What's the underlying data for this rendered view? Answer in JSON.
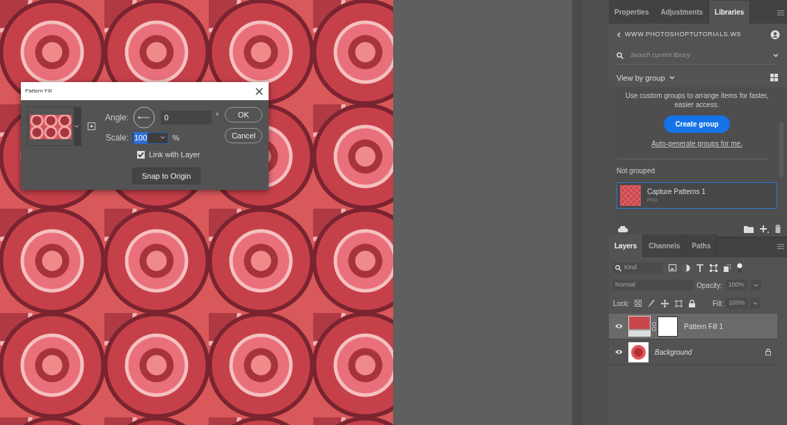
{
  "dialog": {
    "title": "Pattern Fill",
    "angle_label": "Angle:",
    "angle_value": "0",
    "degree_unit": "°",
    "scale_label": "Scale:",
    "scale_value": "100",
    "percent_unit": "%",
    "link_with_layer": {
      "label": "Link with Layer",
      "checked": true
    },
    "snap_button": "Snap to Origin",
    "ok_button": "OK",
    "cancel_button": "Cancel"
  },
  "libraries_panel": {
    "tabs": [
      {
        "label": "Properties",
        "selected": false
      },
      {
        "label": "Adjustments",
        "selected": false
      },
      {
        "label": "Libraries",
        "selected": true
      }
    ],
    "library_name": "WWW.PHOTOSHOPTUTORIALS.WS",
    "search": {
      "placeholder": "Search current library"
    },
    "view_by": "View by group",
    "hint": "Use custom groups to arrange items for faster, easier access.",
    "create_button": "Create group",
    "auto_link": "Auto-generate groups for me.",
    "section_label": "Not grouped",
    "items": [
      {
        "name": "Capture Patterns 1",
        "type": "PNG",
        "selected": true
      }
    ]
  },
  "layers_panel": {
    "tabs": [
      {
        "label": "Layers",
        "selected": true
      },
      {
        "label": "Channels",
        "selected": false
      },
      {
        "label": "Paths",
        "selected": false
      }
    ],
    "kind_placeholder": "Kind",
    "blend_mode": "Normal",
    "opacity_label": "Opacity:",
    "opacity_value": "100%",
    "lock_label": "Lock:",
    "fill_label": "Fill:",
    "fill_value": "100%",
    "layers": [
      {
        "kind": "pattern",
        "name": "Pattern Fill 1",
        "visible": true,
        "selected": true,
        "locked": false
      },
      {
        "kind": "background",
        "name": "Background",
        "visible": true,
        "selected": false,
        "locked": true
      }
    ]
  }
}
